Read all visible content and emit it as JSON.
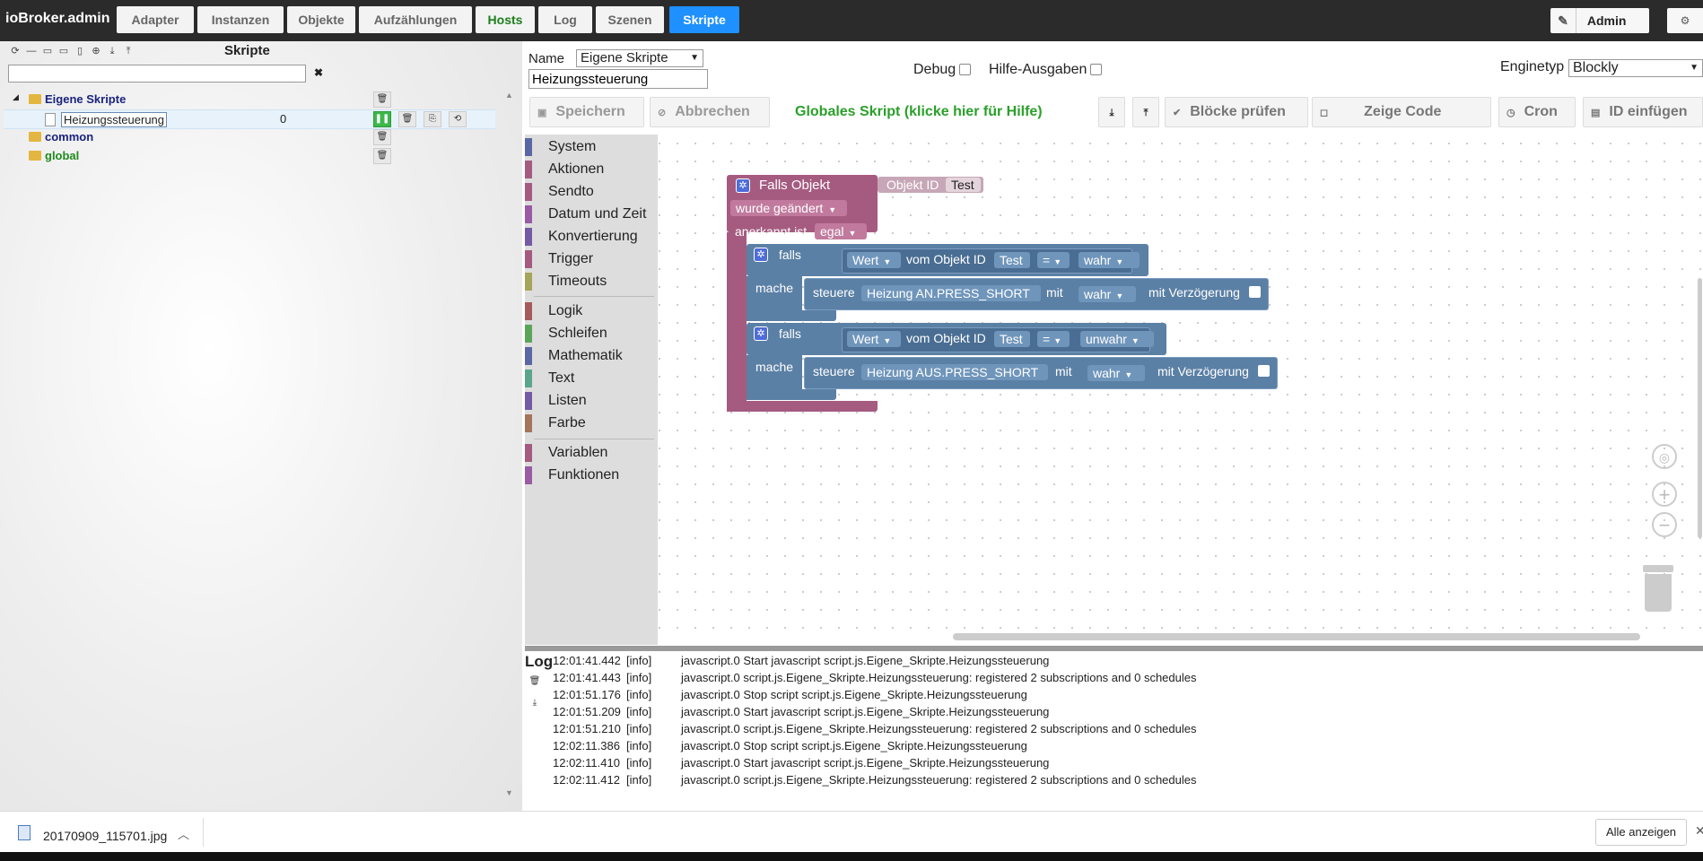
{
  "app": {
    "title": "ioBroker.admin"
  },
  "nav": {
    "tabs": [
      {
        "label": "Adapter"
      },
      {
        "label": "Instanzen"
      },
      {
        "label": "Objekte"
      },
      {
        "label": "Aufzählungen"
      },
      {
        "label": "Hosts"
      },
      {
        "label": "Log"
      },
      {
        "label": "Szenen"
      },
      {
        "label": "Skripte"
      }
    ],
    "active_tab": "Skripte",
    "user_label": "Admin"
  },
  "left": {
    "title": "Skripte",
    "filter_value": "",
    "tree": [
      {
        "label": "Eigene Skripte",
        "type": "folder",
        "expanded": true
      },
      {
        "label": "Heizungssteuerung",
        "type": "script",
        "count": "0",
        "selected": true
      },
      {
        "label": "common",
        "type": "folder"
      },
      {
        "label": "global",
        "type": "folder"
      }
    ]
  },
  "editor": {
    "name_label": "Name",
    "name_select": "Eigene Skripte",
    "script_name": "Heizungssteuerung",
    "debug_label": "Debug",
    "hilfe_label": "Hilfe-Ausgaben",
    "engine_label": "Enginetyp",
    "engine_value": "Blockly",
    "buttons": {
      "save": "Speichern",
      "cancel": "Abbrechen",
      "global_hint": "Globales Skript (klicke hier für Hilfe)",
      "check": "Blöcke prüfen",
      "show_code": "Zeige Code",
      "cron": "Cron",
      "insert_id": "ID einfügen"
    }
  },
  "toolbox": {
    "categories": [
      {
        "label": "System",
        "color": "#5b67a5"
      },
      {
        "label": "Aktionen",
        "color": "#a55b80"
      },
      {
        "label": "Sendto",
        "color": "#a55b80"
      },
      {
        "label": "Datum und Zeit",
        "color": "#995ba5"
      },
      {
        "label": "Konvertierung",
        "color": "#745ba5"
      },
      {
        "label": "Trigger",
        "color": "#a55b80"
      },
      {
        "label": "Timeouts",
        "color": "#a5a55b"
      },
      {
        "label": "Logik",
        "color": "#a55b5b"
      },
      {
        "label": "Schleifen",
        "color": "#5ba55b"
      },
      {
        "label": "Mathematik",
        "color": "#5b67a5"
      },
      {
        "label": "Text",
        "color": "#5ba58c"
      },
      {
        "label": "Listen",
        "color": "#745ba5"
      },
      {
        "label": "Farbe",
        "color": "#a5745b"
      },
      {
        "label": "Variablen",
        "color": "#a55b80"
      },
      {
        "label": "Funktionen",
        "color": "#995ba5"
      }
    ]
  },
  "blocks": {
    "trigger": {
      "title": "Falls Objekt",
      "object_id_label": "Objekt ID",
      "object_id": "Test",
      "condition": "wurde geändert",
      "ack_label": "anerkannt ist",
      "ack_value": "egal",
      "color": "#a55b80"
    },
    "if1": {
      "falls": "falls",
      "wert": "Wert",
      "vom": "vom Objekt ID",
      "id": "Test",
      "op": "=",
      "value": "wahr",
      "mache": "mache",
      "steuere": "steuere",
      "target": "Heizung AN.PRESS_SHORT",
      "mit": "mit",
      "set_value": "wahr",
      "delay": "mit Verzögerung"
    },
    "if2": {
      "falls": "falls",
      "wert": "Wert",
      "vom": "vom Objekt ID",
      "id": "Test",
      "op": "=",
      "value": "unwahr",
      "mache": "mache",
      "steuere": "steuere",
      "target": "Heizung AUS.PRESS_SHORT",
      "mit": "mit",
      "set_value": "wahr",
      "delay": "mit Verzögerung"
    },
    "logic_color": "#5b80a5"
  },
  "log": {
    "title": "Log",
    "rows": [
      {
        "time": "12:01:41.442",
        "sev": "[info]",
        "msg": "javascript.0 Start javascript script.js.Eigene_Skripte.Heizungssteuerung"
      },
      {
        "time": "12:01:41.443",
        "sev": "[info]",
        "msg": "javascript.0 script.js.Eigene_Skripte.Heizungssteuerung: registered 2 subscriptions and 0 schedules"
      },
      {
        "time": "12:01:51.176",
        "sev": "[info]",
        "msg": "javascript.0 Stop script script.js.Eigene_Skripte.Heizungssteuerung"
      },
      {
        "time": "12:01:51.209",
        "sev": "[info]",
        "msg": "javascript.0 Start javascript script.js.Eigene_Skripte.Heizungssteuerung"
      },
      {
        "time": "12:01:51.210",
        "sev": "[info]",
        "msg": "javascript.0 script.js.Eigene_Skripte.Heizungssteuerung: registered 2 subscriptions and 0 schedules"
      },
      {
        "time": "12:02:11.386",
        "sev": "[info]",
        "msg": "javascript.0 Stop script script.js.Eigene_Skripte.Heizungssteuerung"
      },
      {
        "time": "12:02:11.410",
        "sev": "[info]",
        "msg": "javascript.0 Start javascript script.js.Eigene_Skripte.Heizungssteuerung"
      },
      {
        "time": "12:02:11.412",
        "sev": "[info]",
        "msg": "javascript.0 script.js.Eigene_Skripte.Heizungssteuerung: registered 2 subscriptions and 0 schedules"
      }
    ]
  },
  "downloads": {
    "file": "20170909_115701.jpg",
    "show_all": "Alle anzeigen"
  }
}
